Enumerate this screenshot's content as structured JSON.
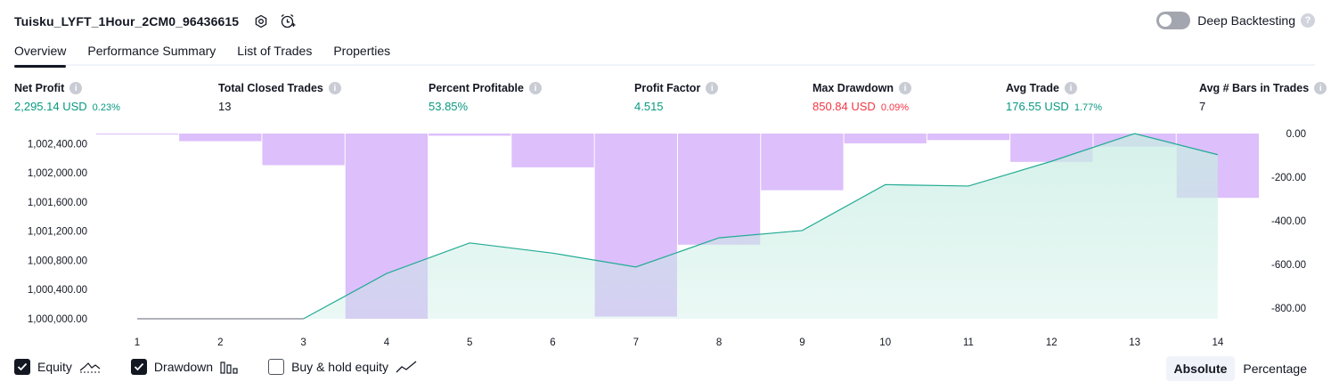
{
  "header": {
    "title": "Tuisku_LYFT_1Hour_2CM0_96436615",
    "deep_backtesting_label": "Deep Backtesting"
  },
  "tabs": [
    {
      "label": "Overview",
      "active": true
    },
    {
      "label": "Performance Summary",
      "active": false
    },
    {
      "label": "List of Trades",
      "active": false
    },
    {
      "label": "Properties",
      "active": false
    }
  ],
  "metrics": [
    {
      "label": "Net Profit",
      "value": "2,295.14 USD",
      "sub": "0.23%",
      "color": "#089981"
    },
    {
      "label": "Total Closed Trades",
      "value": "13",
      "sub": "",
      "color": "#131722"
    },
    {
      "label": "Percent Profitable",
      "value": "53.85%",
      "sub": "",
      "color": "#089981"
    },
    {
      "label": "Profit Factor",
      "value": "4.515",
      "sub": "",
      "color": "#089981"
    },
    {
      "label": "Max Drawdown",
      "value": "850.84 USD",
      "sub": "0.09%",
      "color": "#f23645"
    },
    {
      "label": "Avg Trade",
      "value": "176.55 USD",
      "sub": "1.77%",
      "color": "#089981"
    },
    {
      "label": "Avg # Bars in Trades",
      "value": "7",
      "sub": "",
      "color": "#131722"
    }
  ],
  "chart_data": {
    "type": "line",
    "x": [
      1,
      2,
      3,
      4,
      5,
      6,
      7,
      8,
      9,
      10,
      11,
      12,
      13,
      14
    ],
    "equity": [
      1000000,
      1000000,
      1000000,
      1000620,
      1001040,
      1000900,
      1000710,
      1001110,
      1001210,
      1001840,
      1001820,
      1002160,
      1002540,
      1002250
    ],
    "drawdown_bars": [
      0,
      -35,
      -145,
      -850,
      -10,
      -155,
      -840,
      -510,
      -260,
      -45,
      -30,
      -130,
      -60,
      -295
    ],
    "left_axis": {
      "ticks": [
        "1,000,000.00",
        "1,000,400.00",
        "1,000,800.00",
        "1,001,200.00",
        "1,001,600.00",
        "1,002,000.00",
        "1,002,400.00"
      ],
      "min": 1000000,
      "max": 1002540
    },
    "right_axis": {
      "ticks": [
        "0.00",
        "-200.00",
        "-400.00",
        "-600.00",
        "-800.00"
      ],
      "min": -850,
      "max": 0
    },
    "colors": {
      "equity_line": "#22ab94",
      "equity_fill": "#c8ede3",
      "drawdown_fill": "#d6b4fa",
      "flat_line": "#9598a1"
    }
  },
  "legend": {
    "equity": {
      "label": "Equity",
      "checked": true
    },
    "drawdown": {
      "label": "Drawdown",
      "checked": true
    },
    "buy_hold": {
      "label": "Buy & hold equity",
      "checked": false
    }
  },
  "mode": {
    "absolute": "Absolute",
    "percentage": "Percentage"
  }
}
